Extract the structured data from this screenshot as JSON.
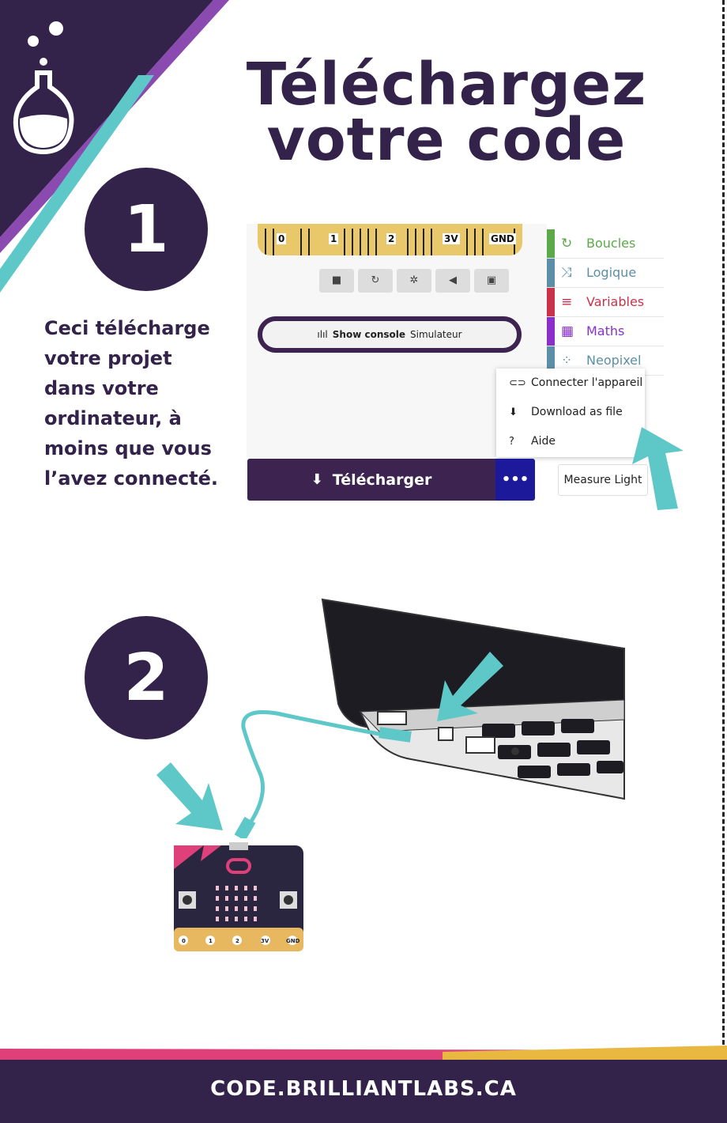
{
  "title": {
    "line1": "Téléchargez",
    "line2": "votre code"
  },
  "step1": {
    "number": "1",
    "lines": [
      "Ceci télécharge",
      "votre projet",
      "dans votre",
      "ordinateur, à",
      "moins que vous",
      "l’avez connecté."
    ]
  },
  "step2": {
    "number": "2"
  },
  "editor": {
    "pins": [
      "0",
      "1",
      "2",
      "3V",
      "GND"
    ],
    "console": {
      "label": "Show console",
      "suffix": "Simulateur"
    },
    "categories": [
      {
        "label": "Boucles",
        "color": "#5ca94a",
        "icon": "loop-icon"
      },
      {
        "label": "Logique",
        "color": "#5b8fa8",
        "icon": "shuffle-icon"
      },
      {
        "label": "Variables",
        "color": "#c8334a",
        "icon": "list-icon"
      },
      {
        "label": "Maths",
        "color": "#8a2fc9",
        "icon": "grid-icon"
      },
      {
        "label": "Neopixel",
        "color": "#5b8fa8",
        "icon": "dots-icon"
      }
    ],
    "menu": [
      {
        "label": "Connecter l'appareil",
        "icon": "link-icon"
      },
      {
        "label": "Download as file",
        "icon": "download-file-icon"
      },
      {
        "label": "Aide",
        "icon": "help-icon"
      }
    ],
    "download_label": "Télécharger",
    "more_label": "•••",
    "measure_label": "Measure Light"
  },
  "board_pins": [
    "0",
    "1",
    "2",
    "3V",
    "GND"
  ],
  "footer": {
    "url": "CODE.BRILLIANTLABS.CA"
  },
  "colors": {
    "primary": "#33224a",
    "teal": "#5ec8c8",
    "pink": "#e0407a",
    "yellow": "#e8b840",
    "purple_accent": "#8a4ab0"
  }
}
